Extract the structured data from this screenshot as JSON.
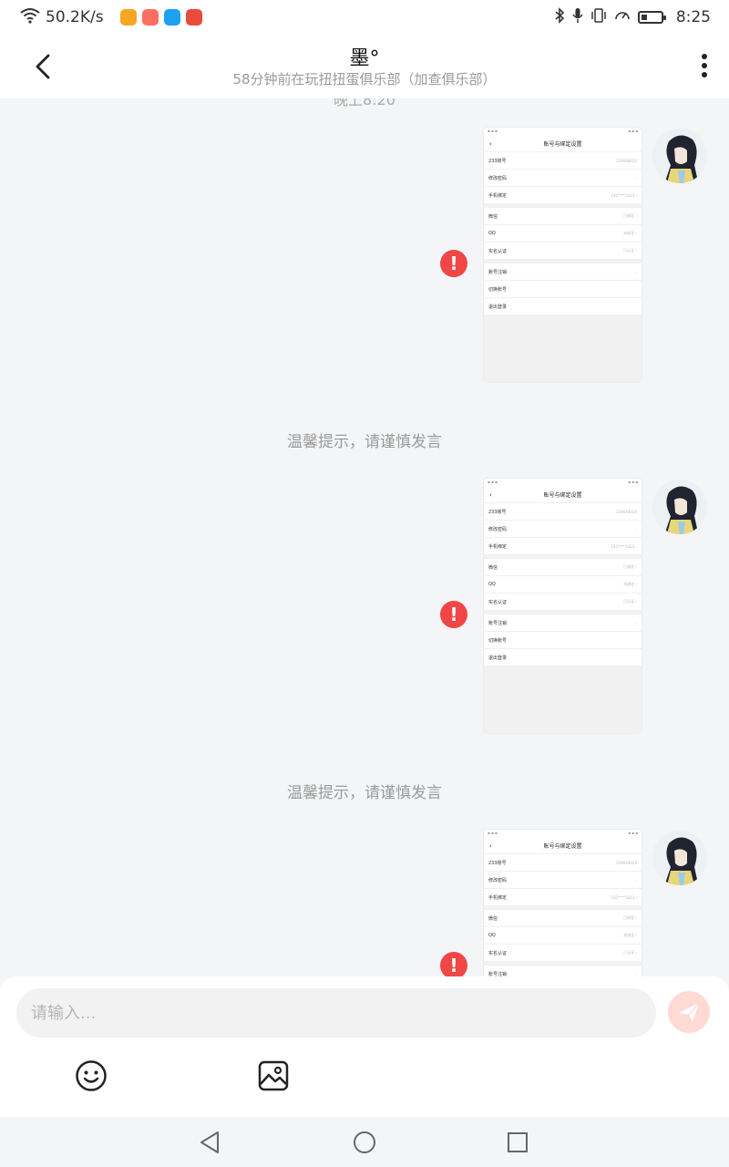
{
  "status_bar": {
    "net_speed": "50.2K/s",
    "time": "8:25",
    "app_icon_colors": [
      "#f5a623",
      "#ff6f61",
      "#1da1f2",
      "#e94b3c"
    ],
    "battery_level": 0.3
  },
  "header": {
    "title": "墨°",
    "subtitle": "58分钟前在玩扭扭蛋俱乐部（加查俱乐部）"
  },
  "chat": {
    "timestamp": "晚上8:20",
    "tip": "温馨提示，请谨慎发言",
    "error_mark": "!"
  },
  "screenshot_thumb": {
    "title": "账号与绑定设置",
    "rows_group1": [
      {
        "label": "233账号",
        "value": "229648020"
      },
      {
        "label": "修改密码",
        "value": "›"
      },
      {
        "label": "手机绑定",
        "value": "182****3423 ›"
      }
    ],
    "rows_group2": [
      {
        "label": "微信",
        "value": "已绑定 ›"
      },
      {
        "label": "QQ",
        "value": "未绑定 ›"
      },
      {
        "label": "实名认证",
        "value": "已认证 ›"
      }
    ],
    "rows_group3": [
      {
        "label": "账号注销",
        "value": "›"
      },
      {
        "label": "切换账号",
        "value": ""
      },
      {
        "label": "退出登录",
        "value": ""
      }
    ]
  },
  "input": {
    "placeholder": "请输入..."
  },
  "colors": {
    "accent": "#f04646",
    "send_disabled": "#ffd9d4"
  }
}
